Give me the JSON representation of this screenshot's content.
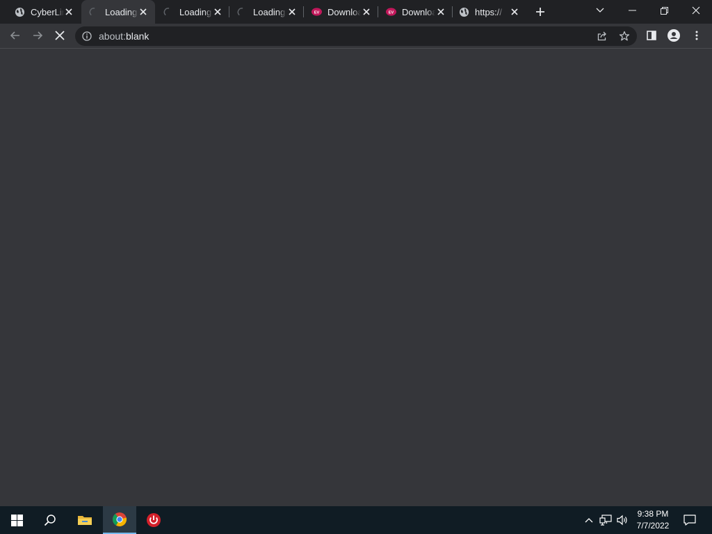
{
  "browser": {
    "tabs": [
      {
        "title": "CyberLink",
        "icon": "globe-icon",
        "active": false
      },
      {
        "title": "Loading...",
        "icon": "loading-spinner-icon",
        "active": true
      },
      {
        "title": "Loading...",
        "icon": "loading-spinner-icon",
        "active": false
      },
      {
        "title": "Loading...",
        "icon": "loading-spinner-icon",
        "active": false
      },
      {
        "title": "Download",
        "icon": "ev-logo-icon",
        "active": false
      },
      {
        "title": "Download",
        "icon": "ev-logo-icon",
        "active": false
      },
      {
        "title": "https://",
        "icon": "globe-icon",
        "active": false
      }
    ],
    "address_bar": {
      "scheme_prefix": "about:",
      "host": "blank"
    },
    "ev_logo_text": "EV",
    "colors": {
      "tabstrip_bg": "#202124",
      "toolbar_bg": "#35363a",
      "omnibox_bg": "#202124",
      "ev_logo": "#c2185b"
    }
  },
  "taskbar": {
    "time": "9:38 PM",
    "date": "7/7/2022",
    "pinned": [
      "windows-start-icon",
      "search-icon",
      "file-explorer-icon",
      "chrome-icon",
      "power-app-icon"
    ]
  }
}
